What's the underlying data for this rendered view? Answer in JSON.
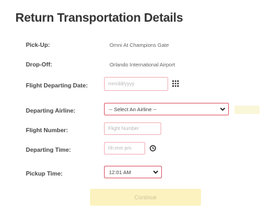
{
  "page": {
    "title": "Return Transportation Details"
  },
  "pickup": {
    "label": "Pick-Up:",
    "value": "Omni At Champions Gate"
  },
  "dropoff": {
    "label": "Drop-Off:",
    "value": "Orlando International Airport"
  },
  "departing_date": {
    "label": "Flight Departing Date:",
    "placeholder": "mm/dd/yyyy",
    "icon": "calendar-icon"
  },
  "airline": {
    "label": "Departing Airline:",
    "selected": "-- Select An Airline --",
    "icon": "chevron-down-icon"
  },
  "flight_number": {
    "label": "Flight Number:",
    "placeholder": "Flight Number"
  },
  "departing_time": {
    "label": "Departing Time:",
    "placeholder": "hh:mm pm",
    "icon": "clock-icon"
  },
  "pickup_time": {
    "label": "Pickup Time:",
    "selected": "12:01 AM",
    "icon": "chevron-down-icon"
  },
  "buttons": {
    "continue": "Continue"
  },
  "colors": {
    "field_border": "#e26a78",
    "continue_bg": "#fbf2bf"
  }
}
